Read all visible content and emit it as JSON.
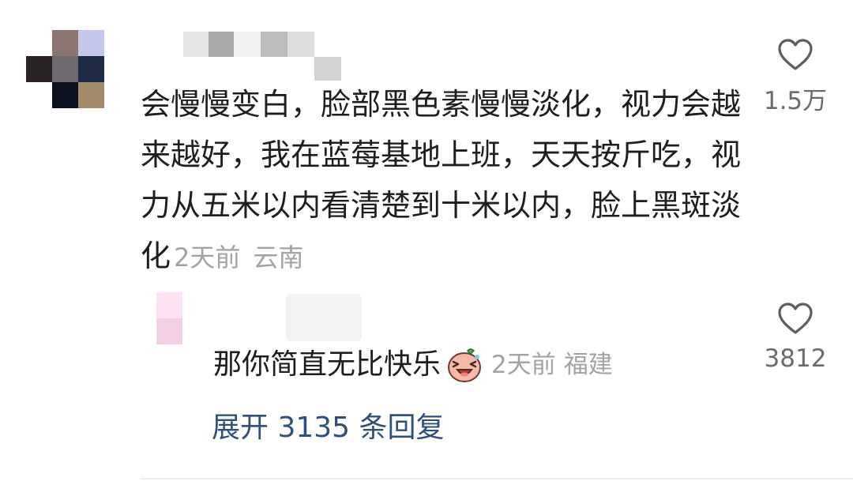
{
  "comment": {
    "text": "会慢慢变白，脸部黑色素慢慢淡化，视力会越来越好，我在蓝莓基地上班，天天按斤吃，视力从五米以内看清楚到十米以内，脸上黑斑淡化",
    "time": "2天前",
    "location": "云南",
    "likes": "1.5万",
    "like_icon": "heart-outline-icon"
  },
  "reply": {
    "text": "那你简直无比快乐",
    "emoji": "laughing-pig-emoji",
    "time": "2天前",
    "location": "福建",
    "likes": "3812",
    "like_icon": "heart-outline-icon"
  },
  "expand": {
    "label": "展开 3135 条回复"
  }
}
